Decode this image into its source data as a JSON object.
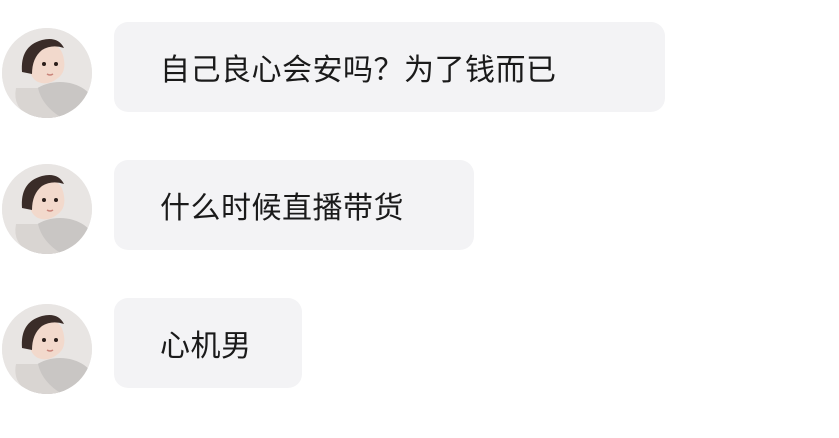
{
  "messages": [
    {
      "avatar_icon": "user-avatar-icon",
      "text": "自己良心会安吗？为了钱而已"
    },
    {
      "avatar_icon": "user-avatar-icon",
      "text": "什么时候直播带货"
    },
    {
      "avatar_icon": "user-avatar-icon",
      "text": "心机男"
    }
  ],
  "colors": {
    "bubble_background": "#f3f3f5",
    "text": "#1a1a1a",
    "page_background": "#ffffff"
  }
}
